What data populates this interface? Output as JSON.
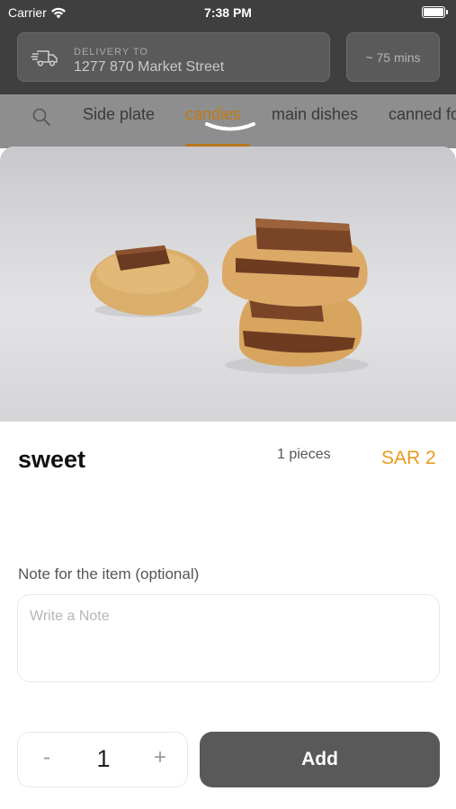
{
  "status_bar": {
    "carrier": "Carrier",
    "time": "7:38 PM"
  },
  "header": {
    "delivery_label": "DELIVERY TO",
    "address": "1277 870 Market Street",
    "eta": "~ 75 mins",
    "truck_icon": "delivery-truck-icon"
  },
  "tabs": {
    "search_icon": "search-icon",
    "items": [
      {
        "label": "Side plate",
        "active": false
      },
      {
        "label": "candies",
        "active": true
      },
      {
        "label": "main dishes",
        "active": false
      },
      {
        "label": "canned fo",
        "active": false
      }
    ]
  },
  "item": {
    "name": "sweet",
    "quantity_text": "1 pieces",
    "price": "SAR 2"
  },
  "note": {
    "label": "Note for the item (optional)",
    "placeholder": "Write a Note",
    "value": ""
  },
  "stepper": {
    "minus": "-",
    "count": "1",
    "plus": "+"
  },
  "add_button": {
    "label": "Add"
  },
  "colors": {
    "accent": "#e89a1c",
    "active_tab": "#c07a14",
    "header_bg": "#3f3f3f",
    "button_bg": "#595959"
  }
}
